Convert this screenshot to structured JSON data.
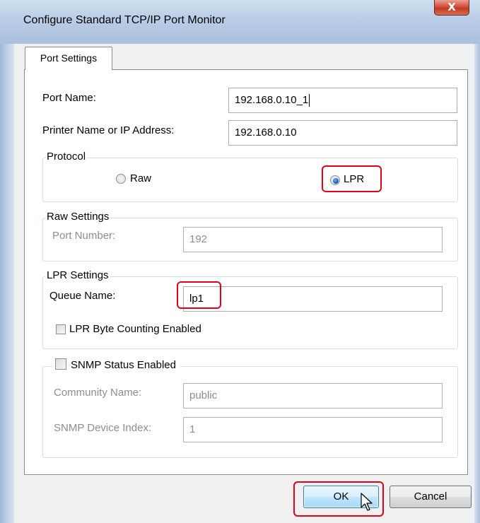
{
  "window": {
    "title": "Configure Standard TCP/IP Port Monitor",
    "close_label": "X"
  },
  "tabs": [
    {
      "label": "Port Settings",
      "selected": true
    }
  ],
  "port_settings": {
    "port_name_label": "Port Name:",
    "port_name_value": "192.168.0.10_1",
    "printer_name_label": "Printer Name or IP Address:",
    "printer_name_value": "192.168.0.10"
  },
  "protocol": {
    "legend": "Protocol",
    "options": [
      {
        "label": "Raw",
        "checked": false
      },
      {
        "label": "LPR",
        "checked": true
      }
    ]
  },
  "raw_settings": {
    "legend": "Raw Settings",
    "port_number_label": "Port Number:",
    "port_number_value": "192",
    "enabled": false
  },
  "lpr_settings": {
    "legend": "LPR Settings",
    "queue_name_label": "Queue Name:",
    "queue_name_value": "lp1",
    "byte_counting_label": "LPR Byte Counting Enabled",
    "byte_counting_checked": false
  },
  "snmp": {
    "legend": "SNMP Status Enabled",
    "enabled_checked": false,
    "community_name_label": "Community Name:",
    "community_name_value": "public",
    "device_index_label": "SNMP Device Index:",
    "device_index_value": "1"
  },
  "buttons": {
    "ok_label": "OK",
    "cancel_label": "Cancel"
  },
  "colors": {
    "annotation_red": "#e0001b",
    "radio_selected": "#1560c4"
  },
  "icons": [
    "close-icon",
    "mouse-cursor-icon"
  ]
}
